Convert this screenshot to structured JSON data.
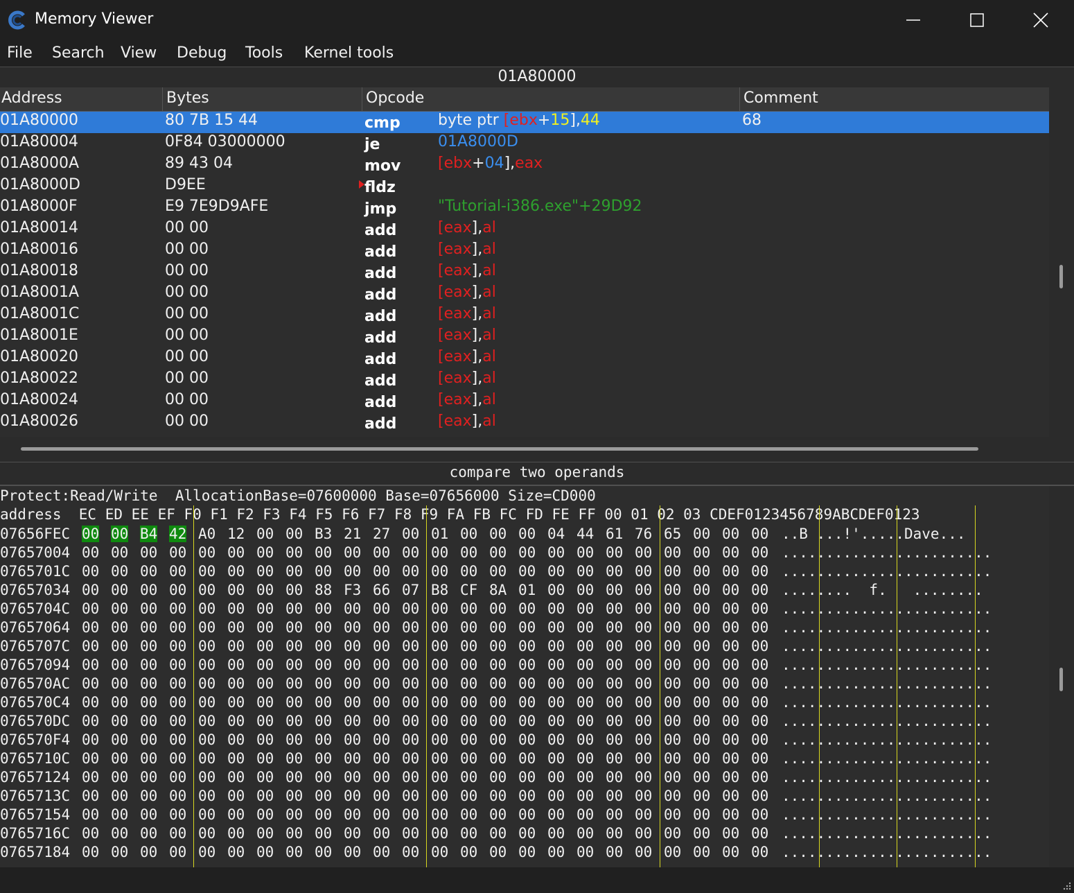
{
  "window": {
    "title": "Memory Viewer",
    "controls": [
      "minimize-icon",
      "maximize-icon",
      "close-icon"
    ]
  },
  "menu": [
    "File",
    "Search",
    "View",
    "Debug",
    "Tools",
    "Kernel tools"
  ],
  "address_bar": "01A80000",
  "disassembler": {
    "headers": [
      "Address",
      "Bytes",
      "Opcode",
      "Comment"
    ],
    "rows": [
      {
        "addr": "01A80000",
        "bytes": "80 7B 15 44",
        "mn": "cmp",
        "ops": [
          [
            "byte ptr ",
            ""
          ],
          [
            "[",
            "red"
          ],
          [
            "ebx",
            "red"
          ],
          [
            "+",
            ""
          ],
          [
            "15",
            "yellow"
          ],
          [
            "]",
            ""
          ],
          [
            ",",
            ""
          ],
          [
            "44",
            "yellow"
          ]
        ],
        "comment": "68",
        "selected": true
      },
      {
        "addr": "01A80004",
        "bytes": "0F84 03000000",
        "mn": "je",
        "ops": [
          [
            "01A8000D",
            "blue"
          ]
        ],
        "comment": ""
      },
      {
        "addr": "01A8000A",
        "bytes": "89 43 04",
        "mn": "mov",
        "ops": [
          [
            "[",
            "red"
          ],
          [
            "ebx",
            "red"
          ],
          [
            "+",
            ""
          ],
          [
            "04",
            "blue"
          ],
          [
            "]",
            ""
          ],
          [
            ",",
            ""
          ],
          [
            "eax",
            "red"
          ]
        ],
        "comment": ""
      },
      {
        "addr": "01A8000D",
        "bytes": "D9EE",
        "mn": "fldz",
        "ops": [],
        "comment": "",
        "marker": true
      },
      {
        "addr": "01A8000F",
        "bytes": "E9 7E9D9AFE",
        "mn": "jmp",
        "ops": [
          [
            "\"Tutorial-i386.exe\"+29D92",
            "green"
          ]
        ],
        "comment": ""
      },
      {
        "addr": "01A80014",
        "bytes": "00 00",
        "mn": "add",
        "ops": [
          [
            "[",
            "red"
          ],
          [
            "eax",
            "red"
          ],
          [
            "]",
            ""
          ],
          [
            ",",
            ""
          ],
          [
            "al",
            "red"
          ]
        ],
        "comment": ""
      },
      {
        "addr": "01A80016",
        "bytes": "00 00",
        "mn": "add",
        "ops": [
          [
            "[",
            "red"
          ],
          [
            "eax",
            "red"
          ],
          [
            "]",
            ""
          ],
          [
            ",",
            ""
          ],
          [
            "al",
            "red"
          ]
        ],
        "comment": ""
      },
      {
        "addr": "01A80018",
        "bytes": "00 00",
        "mn": "add",
        "ops": [
          [
            "[",
            "red"
          ],
          [
            "eax",
            "red"
          ],
          [
            "]",
            ""
          ],
          [
            ",",
            ""
          ],
          [
            "al",
            "red"
          ]
        ],
        "comment": ""
      },
      {
        "addr": "01A8001A",
        "bytes": "00 00",
        "mn": "add",
        "ops": [
          [
            "[",
            "red"
          ],
          [
            "eax",
            "red"
          ],
          [
            "]",
            ""
          ],
          [
            ",",
            ""
          ],
          [
            "al",
            "red"
          ]
        ],
        "comment": ""
      },
      {
        "addr": "01A8001C",
        "bytes": "00 00",
        "mn": "add",
        "ops": [
          [
            "[",
            "red"
          ],
          [
            "eax",
            "red"
          ],
          [
            "]",
            ""
          ],
          [
            ",",
            ""
          ],
          [
            "al",
            "red"
          ]
        ],
        "comment": ""
      },
      {
        "addr": "01A8001E",
        "bytes": "00 00",
        "mn": "add",
        "ops": [
          [
            "[",
            "red"
          ],
          [
            "eax",
            "red"
          ],
          [
            "]",
            ""
          ],
          [
            ",",
            ""
          ],
          [
            "al",
            "red"
          ]
        ],
        "comment": ""
      },
      {
        "addr": "01A80020",
        "bytes": "00 00",
        "mn": "add",
        "ops": [
          [
            "[",
            "red"
          ],
          [
            "eax",
            "red"
          ],
          [
            "]",
            ""
          ],
          [
            ",",
            ""
          ],
          [
            "al",
            "red"
          ]
        ],
        "comment": ""
      },
      {
        "addr": "01A80022",
        "bytes": "00 00",
        "mn": "add",
        "ops": [
          [
            "[",
            "red"
          ],
          [
            "eax",
            "red"
          ],
          [
            "]",
            ""
          ],
          [
            ",",
            ""
          ],
          [
            "al",
            "red"
          ]
        ],
        "comment": ""
      },
      {
        "addr": "01A80024",
        "bytes": "00 00",
        "mn": "add",
        "ops": [
          [
            "[",
            "red"
          ],
          [
            "eax",
            "red"
          ],
          [
            "]",
            ""
          ],
          [
            ",",
            ""
          ],
          [
            "al",
            "red"
          ]
        ],
        "comment": ""
      },
      {
        "addr": "01A80026",
        "bytes": "00 00",
        "mn": "add",
        "ops": [
          [
            "[",
            "red"
          ],
          [
            "eax",
            "red"
          ],
          [
            "]",
            ""
          ],
          [
            ",",
            ""
          ],
          [
            "al",
            "red"
          ]
        ],
        "comment": ""
      }
    ]
  },
  "status": "compare two operands",
  "hex": {
    "info": "Protect:Read/Write  AllocationBase=07600000 Base=07656000 Size=CD000",
    "header": "address  EC ED EE EF F0 F1 F2 F3 F4 F5 F6 F7 F8 F9 FA FB FC FD FE FF 00 01 02 03 CDEF0123456789ABCDEF0123",
    "rows": [
      {
        "addr": "07656FEC",
        "bytes": [
          "00",
          "00",
          "B4",
          "42",
          "A0",
          "12",
          "00",
          "00",
          "B3",
          "21",
          "27",
          "00",
          "01",
          "00",
          "00",
          "00",
          "04",
          "44",
          "61",
          "76",
          "65",
          "00",
          "00",
          "00"
        ],
        "ascii": "..B ...!'.....Dave...",
        "hl": [
          0,
          1,
          2,
          3
        ]
      },
      {
        "addr": "07657004",
        "bytes": [
          "00",
          "00",
          "00",
          "00",
          "00",
          "00",
          "00",
          "00",
          "00",
          "00",
          "00",
          "00",
          "00",
          "00",
          "00",
          "00",
          "00",
          "00",
          "00",
          "00",
          "00",
          "00",
          "00",
          "00"
        ],
        "ascii": "........................"
      },
      {
        "addr": "0765701C",
        "bytes": [
          "00",
          "00",
          "00",
          "00",
          "00",
          "00",
          "00",
          "00",
          "00",
          "00",
          "00",
          "00",
          "00",
          "00",
          "00",
          "00",
          "00",
          "00",
          "00",
          "00",
          "00",
          "00",
          "00",
          "00"
        ],
        "ascii": "........................"
      },
      {
        "addr": "07657034",
        "bytes": [
          "00",
          "00",
          "00",
          "00",
          "00",
          "00",
          "00",
          "00",
          "88",
          "F3",
          "66",
          "07",
          "B8",
          "CF",
          "8A",
          "01",
          "00",
          "00",
          "00",
          "00",
          "00",
          "00",
          "00",
          "00"
        ],
        "ascii": "........  f.   ........"
      },
      {
        "addr": "0765704C",
        "bytes": [
          "00",
          "00",
          "00",
          "00",
          "00",
          "00",
          "00",
          "00",
          "00",
          "00",
          "00",
          "00",
          "00",
          "00",
          "00",
          "00",
          "00",
          "00",
          "00",
          "00",
          "00",
          "00",
          "00",
          "00"
        ],
        "ascii": "........................"
      },
      {
        "addr": "07657064",
        "bytes": [
          "00",
          "00",
          "00",
          "00",
          "00",
          "00",
          "00",
          "00",
          "00",
          "00",
          "00",
          "00",
          "00",
          "00",
          "00",
          "00",
          "00",
          "00",
          "00",
          "00",
          "00",
          "00",
          "00",
          "00"
        ],
        "ascii": "........................"
      },
      {
        "addr": "0765707C",
        "bytes": [
          "00",
          "00",
          "00",
          "00",
          "00",
          "00",
          "00",
          "00",
          "00",
          "00",
          "00",
          "00",
          "00",
          "00",
          "00",
          "00",
          "00",
          "00",
          "00",
          "00",
          "00",
          "00",
          "00",
          "00"
        ],
        "ascii": "........................"
      },
      {
        "addr": "07657094",
        "bytes": [
          "00",
          "00",
          "00",
          "00",
          "00",
          "00",
          "00",
          "00",
          "00",
          "00",
          "00",
          "00",
          "00",
          "00",
          "00",
          "00",
          "00",
          "00",
          "00",
          "00",
          "00",
          "00",
          "00",
          "00"
        ],
        "ascii": "........................"
      },
      {
        "addr": "076570AC",
        "bytes": [
          "00",
          "00",
          "00",
          "00",
          "00",
          "00",
          "00",
          "00",
          "00",
          "00",
          "00",
          "00",
          "00",
          "00",
          "00",
          "00",
          "00",
          "00",
          "00",
          "00",
          "00",
          "00",
          "00",
          "00"
        ],
        "ascii": "........................"
      },
      {
        "addr": "076570C4",
        "bytes": [
          "00",
          "00",
          "00",
          "00",
          "00",
          "00",
          "00",
          "00",
          "00",
          "00",
          "00",
          "00",
          "00",
          "00",
          "00",
          "00",
          "00",
          "00",
          "00",
          "00",
          "00",
          "00",
          "00",
          "00"
        ],
        "ascii": "........................"
      },
      {
        "addr": "076570DC",
        "bytes": [
          "00",
          "00",
          "00",
          "00",
          "00",
          "00",
          "00",
          "00",
          "00",
          "00",
          "00",
          "00",
          "00",
          "00",
          "00",
          "00",
          "00",
          "00",
          "00",
          "00",
          "00",
          "00",
          "00",
          "00"
        ],
        "ascii": "........................"
      },
      {
        "addr": "076570F4",
        "bytes": [
          "00",
          "00",
          "00",
          "00",
          "00",
          "00",
          "00",
          "00",
          "00",
          "00",
          "00",
          "00",
          "00",
          "00",
          "00",
          "00",
          "00",
          "00",
          "00",
          "00",
          "00",
          "00",
          "00",
          "00"
        ],
        "ascii": "........................"
      },
      {
        "addr": "0765710C",
        "bytes": [
          "00",
          "00",
          "00",
          "00",
          "00",
          "00",
          "00",
          "00",
          "00",
          "00",
          "00",
          "00",
          "00",
          "00",
          "00",
          "00",
          "00",
          "00",
          "00",
          "00",
          "00",
          "00",
          "00",
          "00"
        ],
        "ascii": "........................"
      },
      {
        "addr": "07657124",
        "bytes": [
          "00",
          "00",
          "00",
          "00",
          "00",
          "00",
          "00",
          "00",
          "00",
          "00",
          "00",
          "00",
          "00",
          "00",
          "00",
          "00",
          "00",
          "00",
          "00",
          "00",
          "00",
          "00",
          "00",
          "00"
        ],
        "ascii": "........................"
      },
      {
        "addr": "0765713C",
        "bytes": [
          "00",
          "00",
          "00",
          "00",
          "00",
          "00",
          "00",
          "00",
          "00",
          "00",
          "00",
          "00",
          "00",
          "00",
          "00",
          "00",
          "00",
          "00",
          "00",
          "00",
          "00",
          "00",
          "00",
          "00"
        ],
        "ascii": "........................"
      },
      {
        "addr": "07657154",
        "bytes": [
          "00",
          "00",
          "00",
          "00",
          "00",
          "00",
          "00",
          "00",
          "00",
          "00",
          "00",
          "00",
          "00",
          "00",
          "00",
          "00",
          "00",
          "00",
          "00",
          "00",
          "00",
          "00",
          "00",
          "00"
        ],
        "ascii": "........................"
      },
      {
        "addr": "0765716C",
        "bytes": [
          "00",
          "00",
          "00",
          "00",
          "00",
          "00",
          "00",
          "00",
          "00",
          "00",
          "00",
          "00",
          "00",
          "00",
          "00",
          "00",
          "00",
          "00",
          "00",
          "00",
          "00",
          "00",
          "00",
          "00"
        ],
        "ascii": "........................"
      },
      {
        "addr": "07657184",
        "bytes": [
          "00",
          "00",
          "00",
          "00",
          "00",
          "00",
          "00",
          "00",
          "00",
          "00",
          "00",
          "00",
          "00",
          "00",
          "00",
          "00",
          "00",
          "00",
          "00",
          "00",
          "00",
          "00",
          "00",
          "00"
        ],
        "ascii": "........................"
      }
    ]
  },
  "colors": {
    "selection": "#2f7bd8",
    "register": "#e02020",
    "number": "#3a8ff0",
    "immediate": "#f0f020",
    "symbol": "#2ea02e",
    "highlight": "#0f8a0f",
    "separator": "#d8d820"
  }
}
